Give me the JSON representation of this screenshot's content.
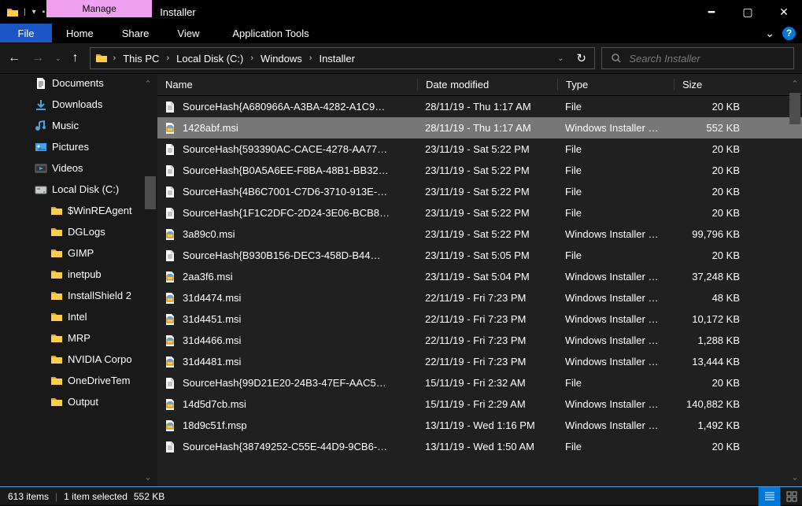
{
  "title": "Installer",
  "manage_label": "Manage",
  "app_tools_label": "Application Tools",
  "file_tab": "File",
  "tabs": {
    "home": "Home",
    "share": "Share",
    "view": "View"
  },
  "breadcrumbs": [
    "This PC",
    "Local Disk (C:)",
    "Windows",
    "Installer"
  ],
  "search_placeholder": "Search Installer",
  "navpane": [
    {
      "label": "Documents",
      "icon": "doc",
      "depth": 0
    },
    {
      "label": "Downloads",
      "icon": "down",
      "depth": 0
    },
    {
      "label": "Music",
      "icon": "music",
      "depth": 0
    },
    {
      "label": "Pictures",
      "icon": "pic",
      "depth": 0
    },
    {
      "label": "Videos",
      "icon": "vid",
      "depth": 0
    },
    {
      "label": "Local Disk (C:)",
      "icon": "disk",
      "depth": 0
    },
    {
      "label": "$WinREAgent",
      "icon": "folder",
      "depth": 1
    },
    {
      "label": "DGLogs",
      "icon": "folder",
      "depth": 1
    },
    {
      "label": "GIMP",
      "icon": "folder",
      "depth": 1
    },
    {
      "label": "inetpub",
      "icon": "folder",
      "depth": 1
    },
    {
      "label": "InstallShield 2",
      "icon": "folder",
      "depth": 1
    },
    {
      "label": "Intel",
      "icon": "folder",
      "depth": 1
    },
    {
      "label": "MRP",
      "icon": "folder",
      "depth": 1
    },
    {
      "label": "NVIDIA Corpo",
      "icon": "folder",
      "depth": 1
    },
    {
      "label": "OneDriveTem",
      "icon": "folder",
      "depth": 1
    },
    {
      "label": "Output",
      "icon": "folder",
      "depth": 1
    }
  ],
  "columns": {
    "name": "Name",
    "date": "Date modified",
    "type": "Type",
    "size": "Size"
  },
  "files": [
    {
      "name": "SourceHash{A680966A-A3BA-4282-A1C9…",
      "date": "28/11/19 - Thu 1:17 AM",
      "type": "File",
      "size": "20 KB",
      "icon": "file"
    },
    {
      "name": "1428abf.msi",
      "date": "28/11/19 - Thu 1:17 AM",
      "type": "Windows Installer …",
      "size": "552 KB",
      "icon": "msi",
      "selected": true
    },
    {
      "name": "SourceHash{593390AC-CACE-4278-AA77…",
      "date": "23/11/19 - Sat 5:22 PM",
      "type": "File",
      "size": "20 KB",
      "icon": "file"
    },
    {
      "name": "SourceHash{B0A5A6EE-F8BA-48B1-BB32…",
      "date": "23/11/19 - Sat 5:22 PM",
      "type": "File",
      "size": "20 KB",
      "icon": "file"
    },
    {
      "name": "SourceHash{4B6C7001-C7D6-3710-913E-…",
      "date": "23/11/19 - Sat 5:22 PM",
      "type": "File",
      "size": "20 KB",
      "icon": "file"
    },
    {
      "name": "SourceHash{1F1C2DFC-2D24-3E06-BCB8…",
      "date": "23/11/19 - Sat 5:22 PM",
      "type": "File",
      "size": "20 KB",
      "icon": "file"
    },
    {
      "name": "3a89c0.msi",
      "date": "23/11/19 - Sat 5:22 PM",
      "type": "Windows Installer …",
      "size": "99,796 KB",
      "icon": "msi"
    },
    {
      "name": "SourceHash{B930B156-DEC3-458D-B44…",
      "date": "23/11/19 - Sat 5:05 PM",
      "type": "File",
      "size": "20 KB",
      "icon": "file"
    },
    {
      "name": "2aa3f6.msi",
      "date": "23/11/19 - Sat 5:04 PM",
      "type": "Windows Installer …",
      "size": "37,248 KB",
      "icon": "msi"
    },
    {
      "name": "31d4474.msi",
      "date": "22/11/19 - Fri 7:23 PM",
      "type": "Windows Installer …",
      "size": "48 KB",
      "icon": "msi"
    },
    {
      "name": "31d4451.msi",
      "date": "22/11/19 - Fri 7:23 PM",
      "type": "Windows Installer …",
      "size": "10,172 KB",
      "icon": "msi"
    },
    {
      "name": "31d4466.msi",
      "date": "22/11/19 - Fri 7:23 PM",
      "type": "Windows Installer …",
      "size": "1,288 KB",
      "icon": "msi"
    },
    {
      "name": "31d4481.msi",
      "date": "22/11/19 - Fri 7:23 PM",
      "type": "Windows Installer …",
      "size": "13,444 KB",
      "icon": "msi"
    },
    {
      "name": "SourceHash{99D21E20-24B3-47EF-AAC5…",
      "date": "15/11/19 - Fri 2:32 AM",
      "type": "File",
      "size": "20 KB",
      "icon": "file"
    },
    {
      "name": "14d5d7cb.msi",
      "date": "15/11/19 - Fri 2:29 AM",
      "type": "Windows Installer …",
      "size": "140,882 KB",
      "icon": "msi"
    },
    {
      "name": "18d9c51f.msp",
      "date": "13/11/19 - Wed 1:16 PM",
      "type": "Windows Installer …",
      "size": "1,492 KB",
      "icon": "msi"
    },
    {
      "name": "SourceHash{38749252-C55E-44D9-9CB6-…",
      "date": "13/11/19 - Wed 1:50 AM",
      "type": "File",
      "size": "20 KB",
      "icon": "file"
    }
  ],
  "status": {
    "items": "613 items",
    "selected": "1 item selected",
    "selsize": "552 KB"
  }
}
